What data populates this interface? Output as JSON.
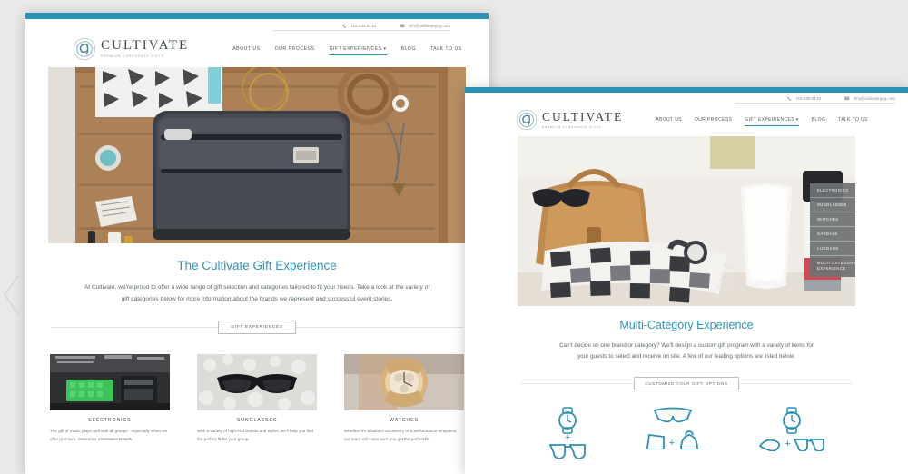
{
  "theme": {
    "accent": "#2c90b7",
    "heading": "#2e93ba",
    "body_text": "#5d686d",
    "page_background": "#e9e9e9",
    "dropdown_background": "#6f7274"
  },
  "window1": {
    "contact": {
      "phone_icon": "phone-icon",
      "phone": "716.636.9133",
      "email_icon": "envelope-icon",
      "email": "info@cultivatepcg.com"
    },
    "logo": {
      "icon": "cultivate-swirl-logo-icon",
      "brand": "CULTIVATE",
      "tagline": "PREMIUM CORPORATE GIFTS"
    },
    "nav": [
      {
        "label": "ABOUT US",
        "active": false,
        "has_caret": false
      },
      {
        "label": "OUR PROCESS",
        "active": false,
        "has_caret": false
      },
      {
        "label": "GIFT EXPERIENCES",
        "active": true,
        "has_caret": true
      },
      {
        "label": "BLOG",
        "active": false,
        "has_caret": false
      },
      {
        "label": "TALK TO US",
        "active": false,
        "has_caret": false
      }
    ],
    "hero_alt": "flat-lay photo of a dark gray toiletry dopp kit bag in a wooden tray with bangles, leather belt, notebook and necklace",
    "section": {
      "title": "The Cultivate Gift Experience",
      "body": "At Cultivate, we're proud to offer a wide range of gift selection and categories tailored to fit your needs. Take a look at the variety of gift categories below for more information about the brands we represent and successful event stories.",
      "cta": "GIFT EXPERIENCES"
    },
    "cards": [
      {
        "title": "ELECTRONICS",
        "desc": "The gift of music plays well with all groups - especially when we offer premium, innovative electronics brands.",
        "image_alt": "green audio equipment and circuit boards on a dark surface"
      },
      {
        "title": "SUNGLASSES",
        "desc": "With a variety of high-end brands and styles, we'll help you find the perfect fit for your group.",
        "image_alt": "black sunglasses resting on a white beaded surface"
      },
      {
        "title": "WATCHES",
        "desc": "Whether it's a fashion accessory or a performance timepiece, our team will make sure you get the perfect fit.",
        "image_alt": "rose gold chronograph wristwatch close up"
      }
    ]
  },
  "window2": {
    "contact": {
      "phone_icon": "phone-icon",
      "phone": "716.636.9133",
      "email_icon": "envelope-icon",
      "email": "info@cultivatepcg.com"
    },
    "logo": {
      "icon": "cultivate-swirl-logo-icon",
      "brand": "CULTIVATE",
      "tagline": "PREMIUM CORPORATE GIFTS"
    },
    "nav": [
      {
        "label": "ABOUT US",
        "active": false,
        "has_caret": false
      },
      {
        "label": "OUR PROCESS",
        "active": false,
        "has_caret": false
      },
      {
        "label": "GIFT EXPERIENCES",
        "active": true,
        "has_caret": true
      },
      {
        "label": "BLOG",
        "active": false,
        "has_caret": false
      },
      {
        "label": "TALK TO US",
        "active": false,
        "has_caret": false
      }
    ],
    "dropdown": [
      "ELECTRONICS",
      "SUNGLASSES",
      "WATCHES",
      "SANDALS",
      "LUGGAGE",
      "MULTI-CATEGORY EXPERIENCE"
    ],
    "hero_alt": "tan leather handbag, sunglasses, buffalo check scarf, watch and white tumblers on a white surface",
    "section": {
      "title": "Multi-Category Experience",
      "body": "Can't decide on one brand or category?  We'll design a custom gift program with a variety of items for your guests to select and receive on site. A few of our leading options are listed below.",
      "cta": "CUSTOMIZE YOUR GIFT OPTIONS"
    },
    "icon_combos": [
      {
        "first": "watch-icon",
        "plus": "+",
        "second": "eyeglasses-icon"
      },
      {
        "first": "wallet-icon",
        "plus": "+",
        "second": "backpack-icon"
      },
      {
        "first": "sandal-icon",
        "plus": "+",
        "second": "eyeglasses-icon"
      },
      {
        "first": "watch-icon",
        "plus": "+",
        "second": "eyeglasses-icon"
      }
    ]
  }
}
